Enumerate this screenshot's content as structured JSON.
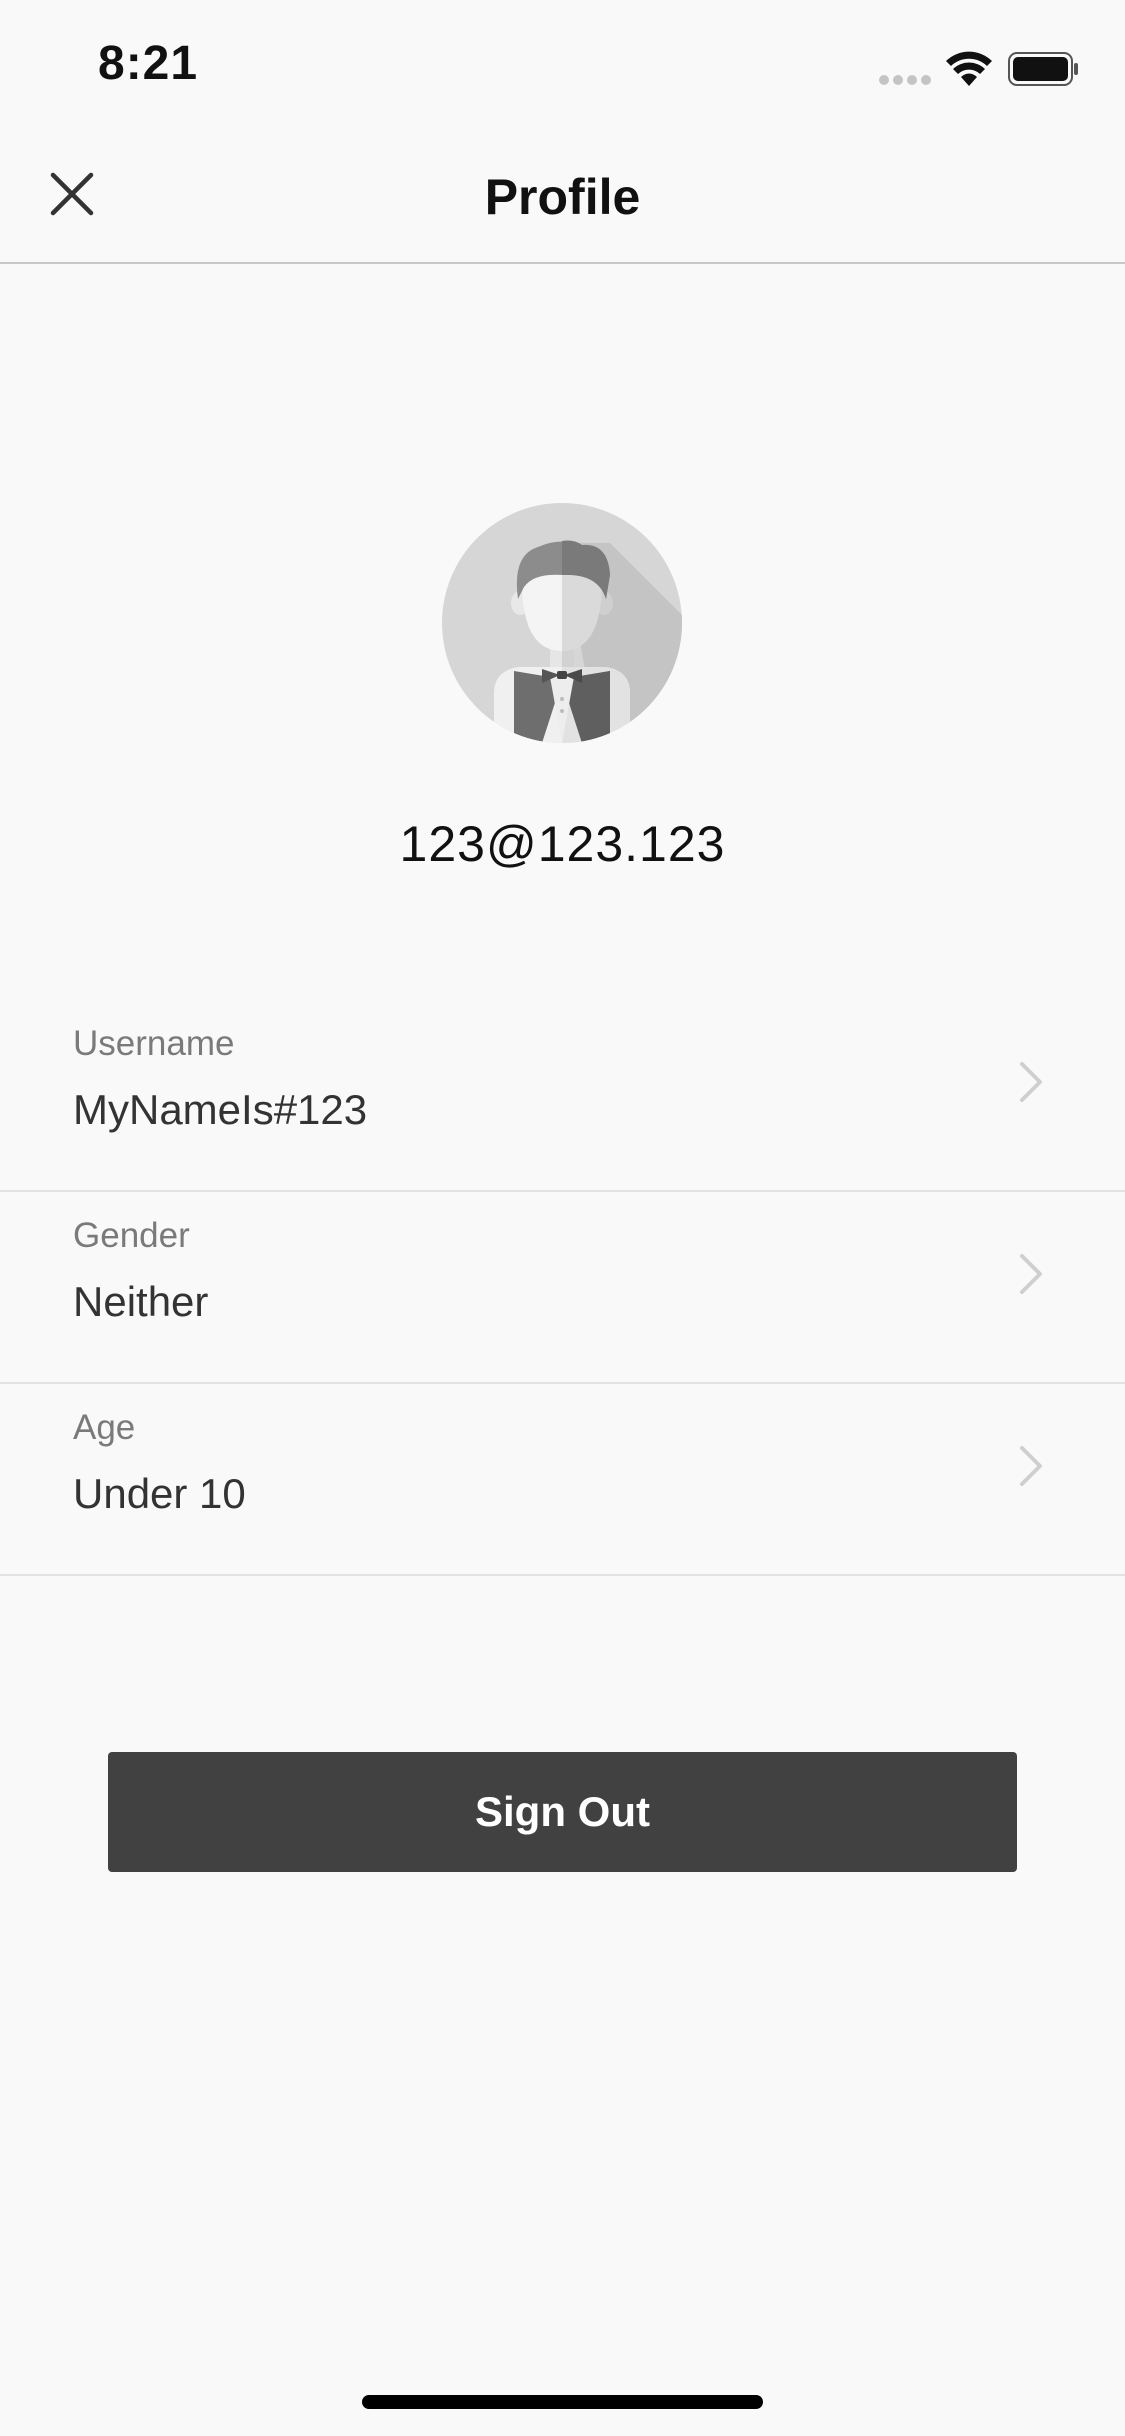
{
  "status_bar": {
    "time": "8:21",
    "signal_icon": "cellular-signal-icon",
    "wifi_icon": "wifi-icon",
    "battery_icon": "battery-icon"
  },
  "nav": {
    "title": "Profile",
    "close_icon": "close-icon"
  },
  "profile": {
    "avatar_icon": "user-avatar-icon",
    "email": "123@123.123"
  },
  "fields": [
    {
      "label": "Username",
      "value": "MyNameIs#123"
    },
    {
      "label": "Gender",
      "value": "Neither"
    },
    {
      "label": "Age",
      "value": "Under 10"
    }
  ],
  "actions": {
    "sign_out_label": "Sign Out"
  },
  "colors": {
    "background": "#f9f9f9",
    "button": "#414141",
    "label": "#7a7a7a"
  }
}
